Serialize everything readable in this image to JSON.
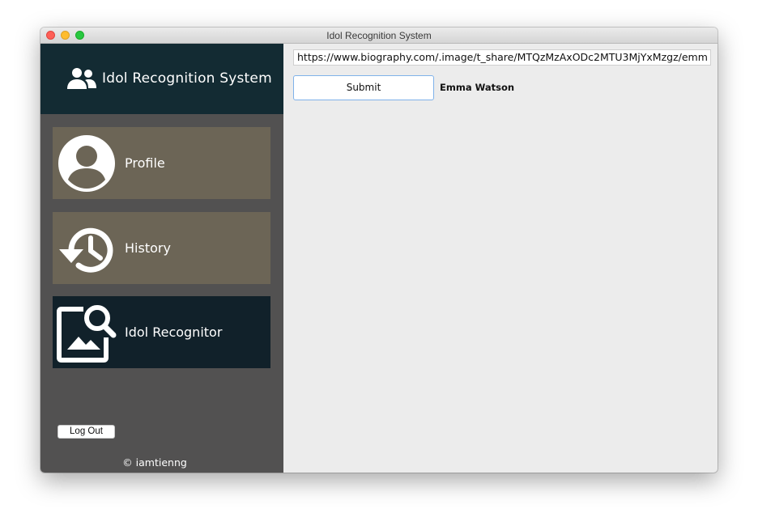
{
  "window": {
    "title": "Idol Recognition System"
  },
  "sidebar": {
    "brand": {
      "icon": "users-icon",
      "title": "Idol Recognition System"
    },
    "items": [
      {
        "label": "Profile",
        "icon": "user-avatar-icon",
        "active": false
      },
      {
        "label": "History",
        "icon": "history-clock-icon",
        "active": false
      },
      {
        "label": "Idol Recognitor",
        "icon": "image-search-icon",
        "active": true
      }
    ],
    "logout_label": "Log Out",
    "copyright": "© iamtienng"
  },
  "main": {
    "url_value": "https://www.biography.com/.image/t_share/MTQzMzAxODc2MTU3MjYxMzgz/emm",
    "submit_label": "Submit",
    "result": "Emma Watson"
  },
  "colors": {
    "brand_bg": "#132b33",
    "sidebar_bg": "#525151",
    "nav_inactive": "#6c6556",
    "nav_active": "#11212a",
    "content_bg": "#ececec"
  }
}
